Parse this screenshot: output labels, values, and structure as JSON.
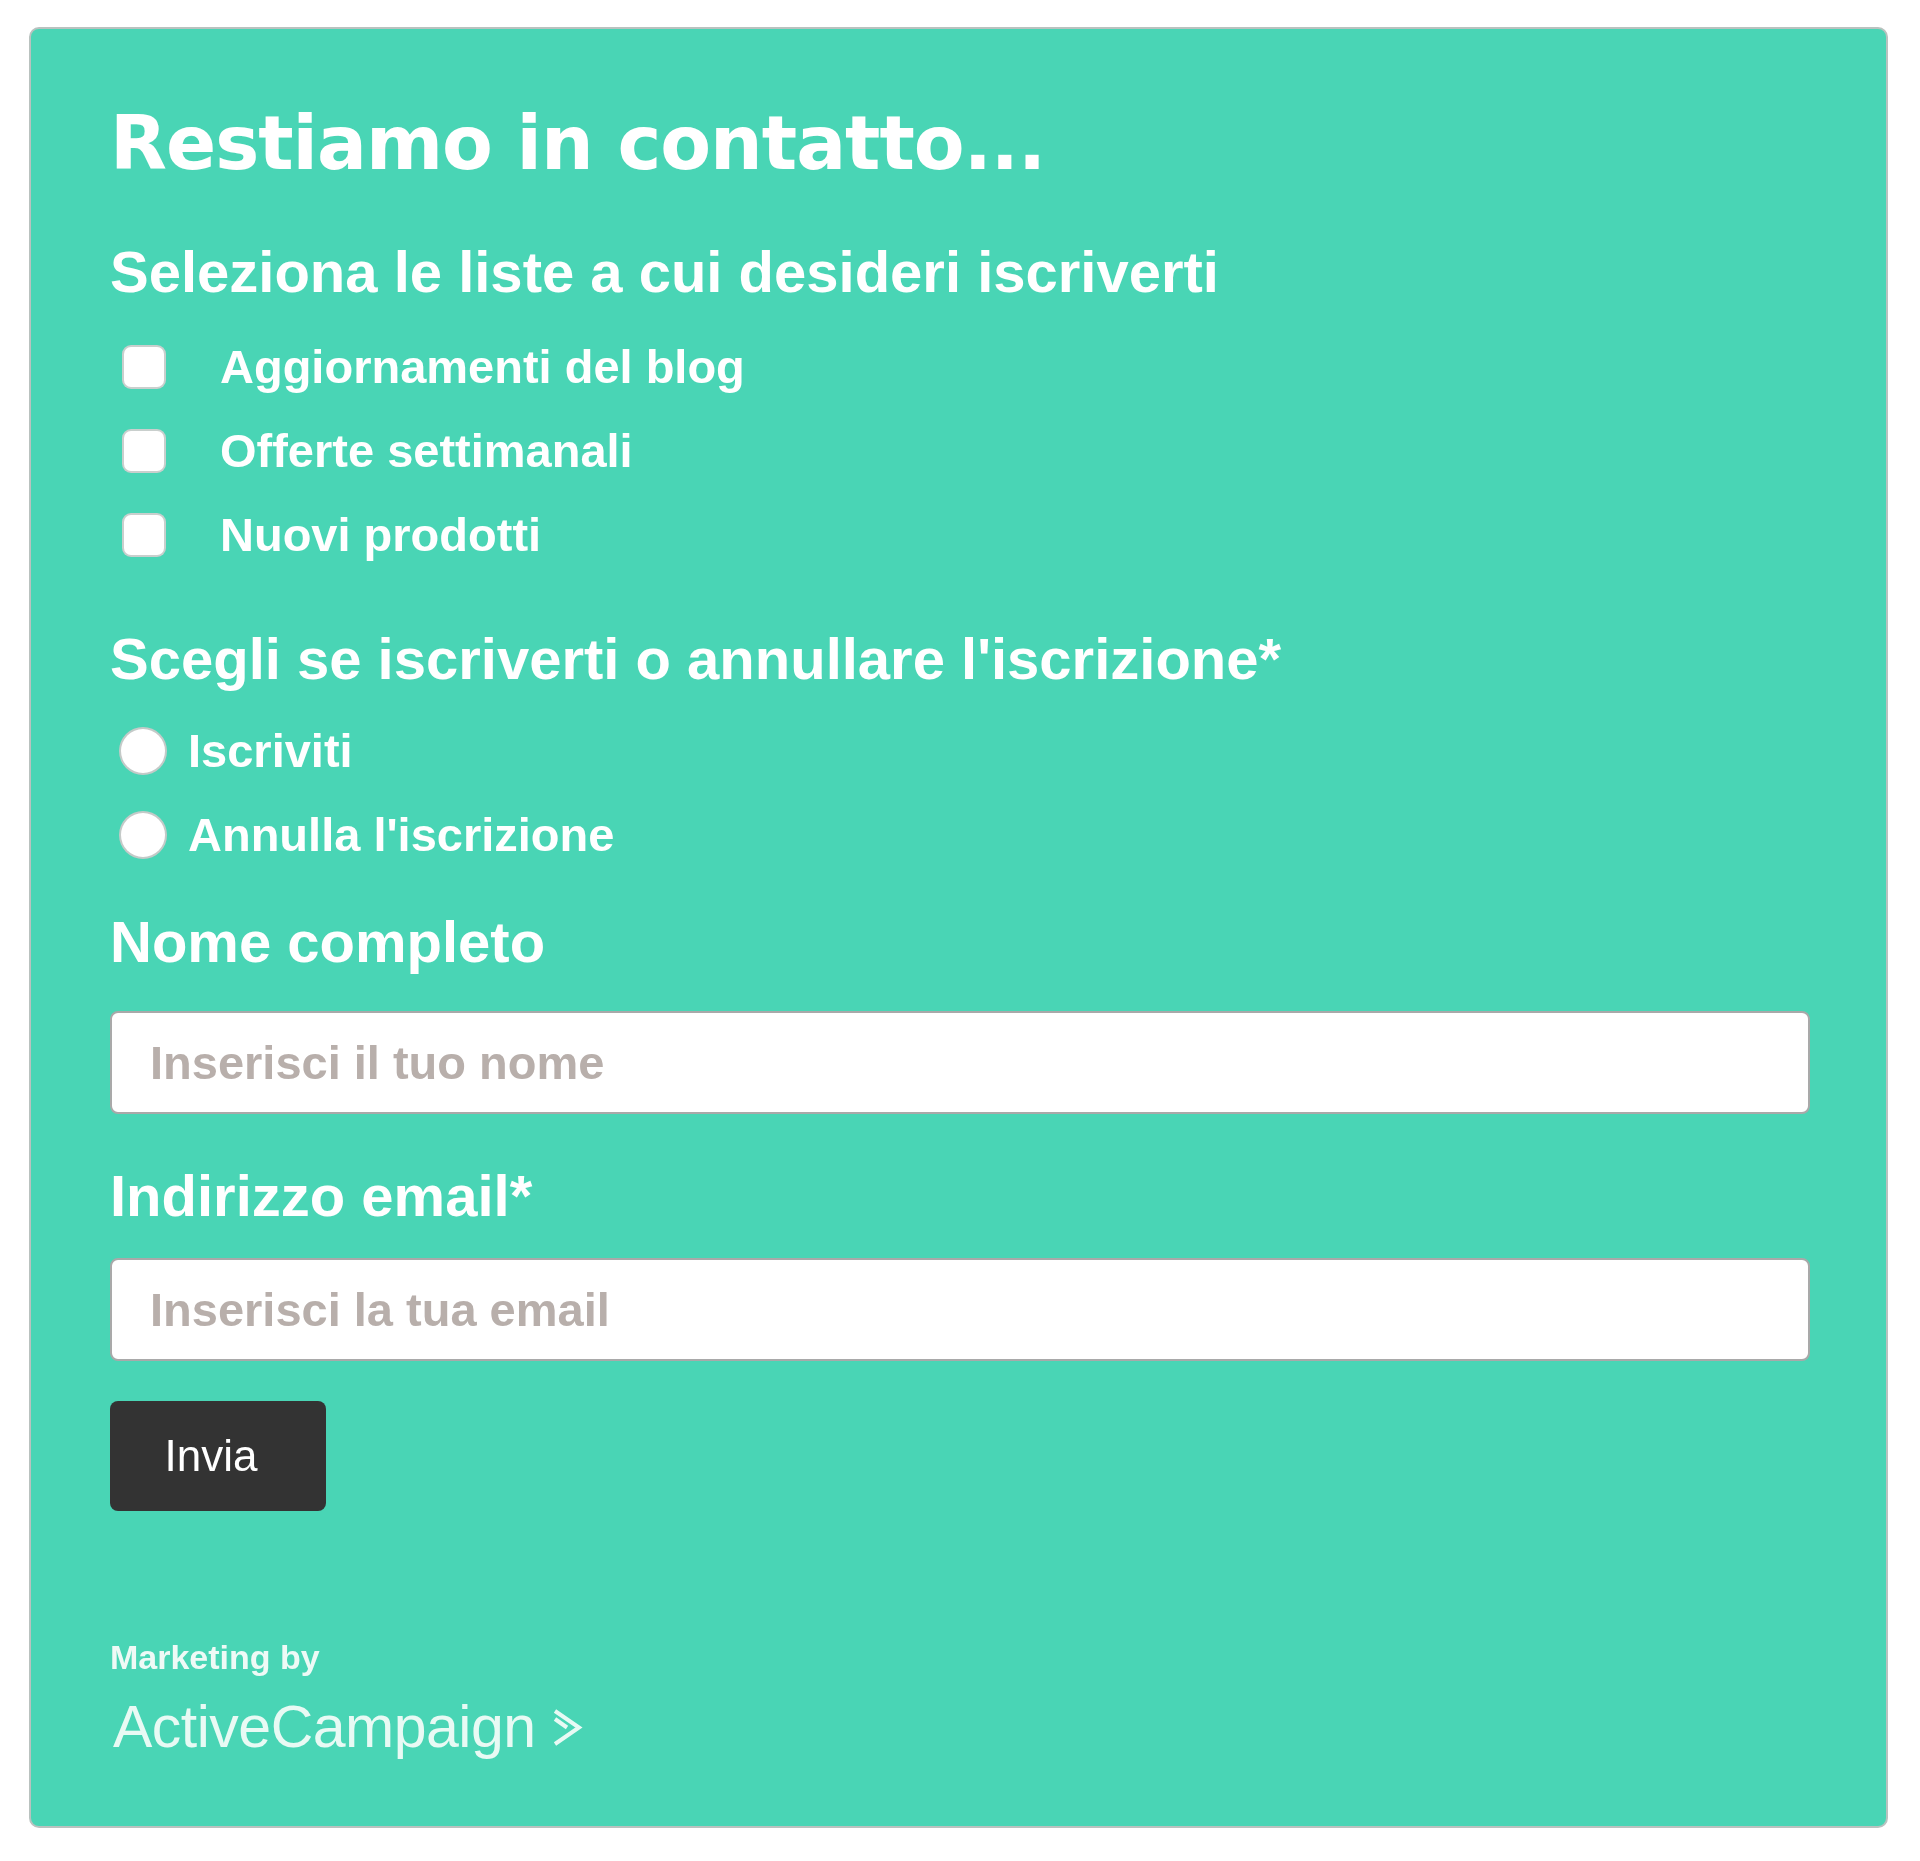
{
  "title": "Restiamo in contatto...",
  "lists": {
    "label": "Seleziona le liste a cui desideri iscriverti",
    "options": [
      {
        "label": "Aggiornamenti del blog",
        "checked": false
      },
      {
        "label": "Offerte settimanali",
        "checked": false
      },
      {
        "label": "Nuovi prodotti",
        "checked": false
      }
    ]
  },
  "subscription": {
    "label": "Scegli se iscriverti o annullare l'iscrizione*",
    "options": [
      {
        "label": "Iscriviti",
        "selected": false
      },
      {
        "label": "Annulla l'iscrizione",
        "selected": false
      }
    ]
  },
  "fields": [
    {
      "label": "Nome completo",
      "placeholder": "Inserisci il tuo nome"
    },
    {
      "label": "Indirizzo email*",
      "placeholder": "Inserisci la tua email"
    }
  ],
  "submit": {
    "label": "Invia"
  },
  "footer": {
    "text": "Marketing by",
    "brand": "ActiveCampaign"
  }
}
